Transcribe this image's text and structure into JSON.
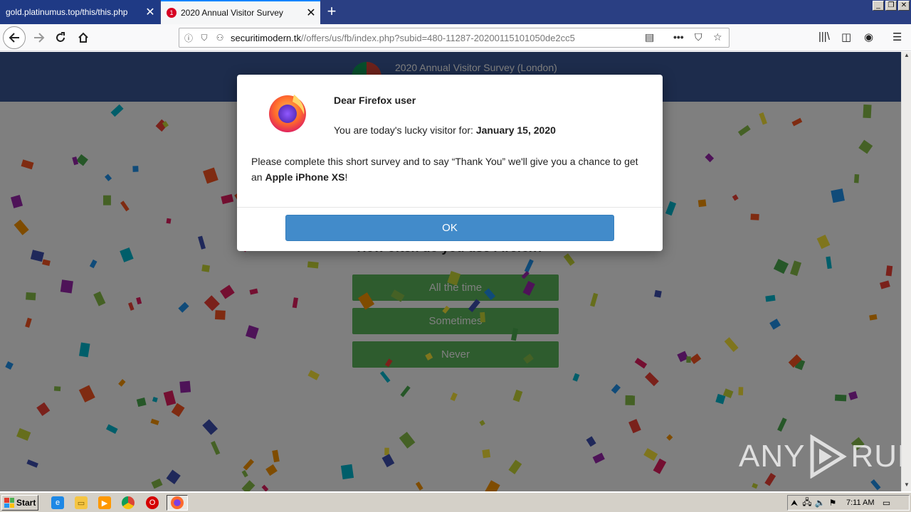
{
  "browser": {
    "tabs": [
      {
        "title": "gold.platinumus.top/this/this.php",
        "active": false
      },
      {
        "title": "2020 Annual Visitor Survey",
        "active": true,
        "badge": "1"
      }
    ],
    "url": {
      "host": "securitimodern.tk",
      "path": "//offers/us/fb/index.php?subid=480-11287-20200115101050de2cc5"
    },
    "window_controls": {
      "minimize": "_",
      "restore": "❐",
      "close": "✕"
    },
    "icons": {
      "back": "arrow-left-icon",
      "forward": "arrow-right-icon",
      "reload": "reload-icon",
      "home": "home-icon",
      "reader": "reader-view-icon",
      "more": "more-icon",
      "pocket": "pocket-icon",
      "bookmark": "star-icon",
      "library": "library-icon",
      "sidebar": "sidebar-icon",
      "account": "account-icon",
      "menu": "hamburger-menu-icon"
    }
  },
  "page": {
    "header_title": "2020 Annual Visitor Survey (London)",
    "question": "How often do you use Firefox?",
    "answers": [
      "All the time",
      "Sometimes",
      "Never"
    ],
    "colors": {
      "header": "#3b5998",
      "answer": "#5cb85c",
      "ok": "#428bca"
    }
  },
  "modal": {
    "greeting": "Dear Firefox user",
    "lucky_prefix": "You are today's lucky visitor for: ",
    "lucky_date": "January 15, 2020",
    "body_prefix": "Please complete this short survey and to say “Thank You” we'll give you a chance to get an ",
    "body_prize": "Apple iPhone XS",
    "body_suffix": "!",
    "ok_label": "OK"
  },
  "watermark": {
    "left": "ANY",
    "right": "RUN"
  },
  "taskbar": {
    "start_label": "Start",
    "clock": "7:11 AM"
  }
}
